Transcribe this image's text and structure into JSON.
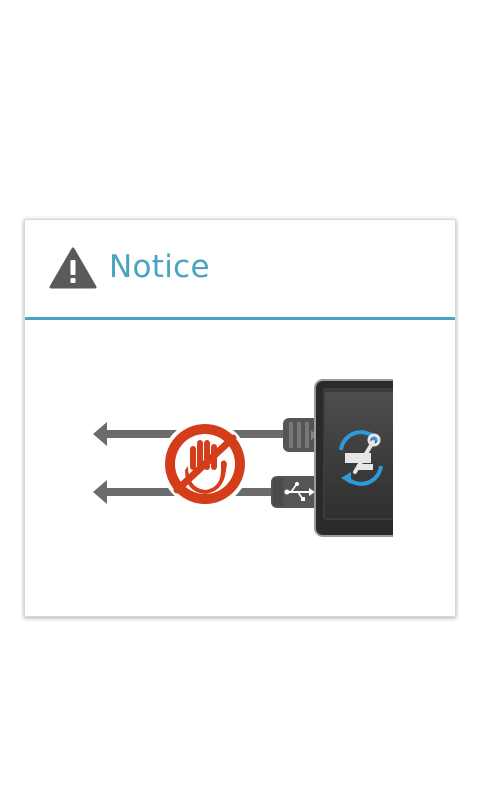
{
  "dialog": {
    "title": "Notice",
    "header_icon": "warning-triangle-icon",
    "illustration": {
      "description_icons": [
        "left-arrow-icon",
        "usb-cable-icon",
        "no-touch-hand-icon",
        "phone-icon",
        "sync-tools-icon"
      ]
    }
  },
  "colors": {
    "accent": "#4aa3c0",
    "warning_icon": "#5a5a5a",
    "prohibit_red": "#d43d1a",
    "cable_gray": "#6b6b6b",
    "phone_dark": "#2a2a2a",
    "sync_blue": "#2e9bd6"
  }
}
